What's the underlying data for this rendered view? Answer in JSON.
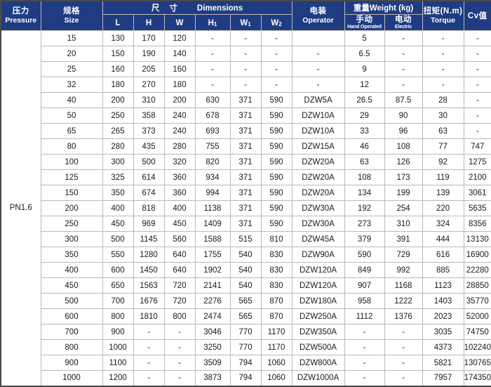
{
  "table": {
    "header": {
      "pressure": {
        "cn": "压力",
        "en": "Pressure"
      },
      "size": {
        "cn": "规格",
        "en": "Size"
      },
      "dimensions_group": {
        "cn": "尺寸",
        "en": "Dimensions"
      },
      "dim_cols": [
        "L",
        "H",
        "W",
        "H1",
        "W1",
        "W2"
      ],
      "operator": {
        "cn": "电装",
        "en": "Operator"
      },
      "weight_group": {
        "cn": "重量",
        "en": "Weight (kg)"
      },
      "weight_manual": {
        "cn": "手动",
        "en": "Hand Operated"
      },
      "weight_electric": {
        "cn": "电动",
        "en": "Electric"
      },
      "torque": {
        "cn": "扭矩(N.m)",
        "en": "Torque"
      },
      "cv": {
        "cn": "Cv值"
      }
    },
    "pressure_value": "PN1.6",
    "columns": [
      "size",
      "L",
      "H",
      "W",
      "H1",
      "W1",
      "W2",
      "operator",
      "weight_manual",
      "weight_electric",
      "torque",
      "cv"
    ],
    "rows": [
      {
        "size": "15",
        "L": "130",
        "H": "170",
        "W": "120",
        "H1": "-",
        "W1": "-",
        "W2": "-",
        "operator": "",
        "weight_manual": "5",
        "weight_electric": "-",
        "torque": "-",
        "cv": "-"
      },
      {
        "size": "20",
        "L": "150",
        "H": "190",
        "W": "140",
        "H1": "-",
        "W1": "-",
        "W2": "-",
        "operator": "-",
        "weight_manual": "6.5",
        "weight_electric": "-",
        "torque": "-",
        "cv": "-"
      },
      {
        "size": "25",
        "L": "160",
        "H": "205",
        "W": "160",
        "H1": "-",
        "W1": "-",
        "W2": "-",
        "operator": "-",
        "weight_manual": "9",
        "weight_electric": "-",
        "torque": "-",
        "cv": "-"
      },
      {
        "size": "32",
        "L": "180",
        "H": "270",
        "W": "180",
        "H1": "-",
        "W1": "-",
        "W2": "-",
        "operator": "-",
        "weight_manual": "12",
        "weight_electric": "-",
        "torque": "-",
        "cv": "-"
      },
      {
        "size": "40",
        "L": "200",
        "H": "310",
        "W": "200",
        "H1": "630",
        "W1": "371",
        "W2": "590",
        "operator": "DZW5A",
        "weight_manual": "26.5",
        "weight_electric": "87.5",
        "torque": "28",
        "cv": "-"
      },
      {
        "size": "50",
        "L": "250",
        "H": "358",
        "W": "240",
        "H1": "678",
        "W1": "371",
        "W2": "590",
        "operator": "DZW10A",
        "weight_manual": "29",
        "weight_electric": "90",
        "torque": "30",
        "cv": "-"
      },
      {
        "size": "65",
        "L": "265",
        "H": "373",
        "W": "240",
        "H1": "693",
        "W1": "371",
        "W2": "590",
        "operator": "DZW10A",
        "weight_manual": "33",
        "weight_electric": "96",
        "torque": "63",
        "cv": "-"
      },
      {
        "size": "80",
        "L": "280",
        "H": "435",
        "W": "280",
        "H1": "755",
        "W1": "371",
        "W2": "590",
        "operator": "DZW15A",
        "weight_manual": "46",
        "weight_electric": "108",
        "torque": "77",
        "cv": "747"
      },
      {
        "size": "100",
        "L": "300",
        "H": "500",
        "W": "320",
        "H1": "820",
        "W1": "371",
        "W2": "590",
        "operator": "DZW20A",
        "weight_manual": "63",
        "weight_electric": "126",
        "torque": "92",
        "cv": "1275"
      },
      {
        "size": "125",
        "L": "325",
        "H": "614",
        "W": "360",
        "H1": "934",
        "W1": "371",
        "W2": "590",
        "operator": "DZW20A",
        "weight_manual": "108",
        "weight_electric": "173",
        "torque": "119",
        "cv": "2100"
      },
      {
        "size": "150",
        "L": "350",
        "H": "674",
        "W": "360",
        "H1": "994",
        "W1": "371",
        "W2": "590",
        "operator": "DZW20A",
        "weight_manual": "134",
        "weight_electric": "199",
        "torque": "139",
        "cv": "3061"
      },
      {
        "size": "200",
        "L": "400",
        "H": "818",
        "W": "400",
        "H1": "1138",
        "W1": "371",
        "W2": "590",
        "operator": "DZW30A",
        "weight_manual": "192",
        "weight_electric": "254",
        "torque": "220",
        "cv": "5635"
      },
      {
        "size": "250",
        "L": "450",
        "H": "969",
        "W": "450",
        "H1": "1409",
        "W1": "371",
        "W2": "590",
        "operator": "DZW30A",
        "weight_manual": "273",
        "weight_electric": "310",
        "torque": "324",
        "cv": "8356"
      },
      {
        "size": "300",
        "L": "500",
        "H": "1145",
        "W": "560",
        "H1": "1588",
        "W1": "515",
        "W2": "810",
        "operator": "DZW45A",
        "weight_manual": "379",
        "weight_electric": "391",
        "torque": "444",
        "cv": "13130"
      },
      {
        "size": "350",
        "L": "550",
        "H": "1280",
        "W": "640",
        "H1": "1755",
        "W1": "540",
        "W2": "830",
        "operator": "DZW90A",
        "weight_manual": "590",
        "weight_electric": "729",
        "torque": "616",
        "cv": "16900"
      },
      {
        "size": "400",
        "L": "600",
        "H": "1450",
        "W": "640",
        "H1": "1902",
        "W1": "540",
        "W2": "830",
        "operator": "DZW120A",
        "weight_manual": "849",
        "weight_electric": "992",
        "torque": "885",
        "cv": "22280"
      },
      {
        "size": "450",
        "L": "650",
        "H": "1563",
        "W": "720",
        "H1": "2141",
        "W1": "540",
        "W2": "830",
        "operator": "DZW120A",
        "weight_manual": "907",
        "weight_electric": "1168",
        "torque": "1123",
        "cv": "28850"
      },
      {
        "size": "500",
        "L": "700",
        "H": "1676",
        "W": "720",
        "H1": "2276",
        "W1": "565",
        "W2": "870",
        "operator": "DZW180A",
        "weight_manual": "958",
        "weight_electric": "1222",
        "torque": "1403",
        "cv": "35770"
      },
      {
        "size": "600",
        "L": "800",
        "H": "1810",
        "W": "800",
        "H1": "2474",
        "W1": "565",
        "W2": "870",
        "operator": "DZW250A",
        "weight_manual": "1112",
        "weight_electric": "1376",
        "torque": "2023",
        "cv": "52000"
      },
      {
        "size": "700",
        "L": "900",
        "H": "-",
        "W": "-",
        "H1": "3046",
        "W1": "770",
        "W2": "1170",
        "operator": "DZW350A",
        "weight_manual": "-",
        "weight_electric": "-",
        "torque": "3035",
        "cv": "74750"
      },
      {
        "size": "800",
        "L": "1000",
        "H": "-",
        "W": "-",
        "H1": "3250",
        "W1": "770",
        "W2": "1170",
        "operator": "DZW500A",
        "weight_manual": "-",
        "weight_electric": "-",
        "torque": "4373",
        "cv": "102240"
      },
      {
        "size": "900",
        "L": "1100",
        "H": "-",
        "W": "-",
        "H1": "3509",
        "W1": "794",
        "W2": "1060",
        "operator": "DZW800A",
        "weight_manual": "-",
        "weight_electric": "-",
        "torque": "5821",
        "cv": "130765"
      },
      {
        "size": "1000",
        "L": "1200",
        "H": "-",
        "W": "-",
        "H1": "3873",
        "W1": "794",
        "W2": "1060",
        "operator": "DZW1000A",
        "weight_manual": "-",
        "weight_electric": "-",
        "torque": "7957",
        "cv": "174350"
      }
    ]
  },
  "colors": {
    "header_bg": "#1f3c82",
    "header_text": "#ffffff",
    "grid_line": "#b9b9b9",
    "outer_border": "#4a4a4a",
    "body_text": "#1a1a1a"
  }
}
